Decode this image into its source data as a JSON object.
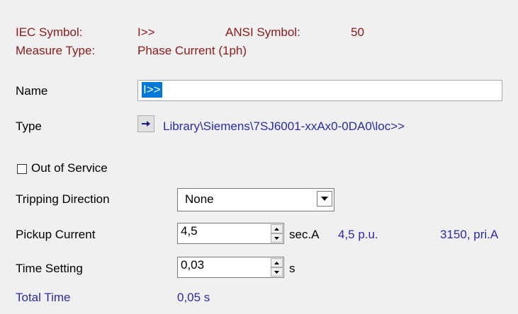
{
  "header": {
    "iec_label": "IEC Symbol:",
    "iec_value": "I>>",
    "ansi_label": "ANSI Symbol:",
    "ansi_value": "50",
    "measure_label": "Measure Type:",
    "measure_value": "Phase Current (1ph)"
  },
  "name": {
    "label": "Name",
    "value": "I>>"
  },
  "type": {
    "label": "Type",
    "link": "Library\\Siemens\\7SJ6001-xxAx0-0DA0\\loc>>"
  },
  "out_of_service": {
    "label": "Out of Service",
    "checked": false
  },
  "tripping": {
    "label": "Tripping Direction",
    "value": "None"
  },
  "pickup": {
    "label": "Pickup Current",
    "value": "4,5",
    "unit": "sec.A",
    "pu": "4,5 p.u.",
    "primary": "3150, pri.A"
  },
  "time": {
    "label": "Time Setting",
    "value": "0,03",
    "unit": "s"
  },
  "total": {
    "label": "Total Time",
    "value": "0,05 s"
  },
  "colors": {
    "maroon": "#8b1a1a",
    "link_blue": "#2a2aa8",
    "selection": "#0078d7"
  }
}
